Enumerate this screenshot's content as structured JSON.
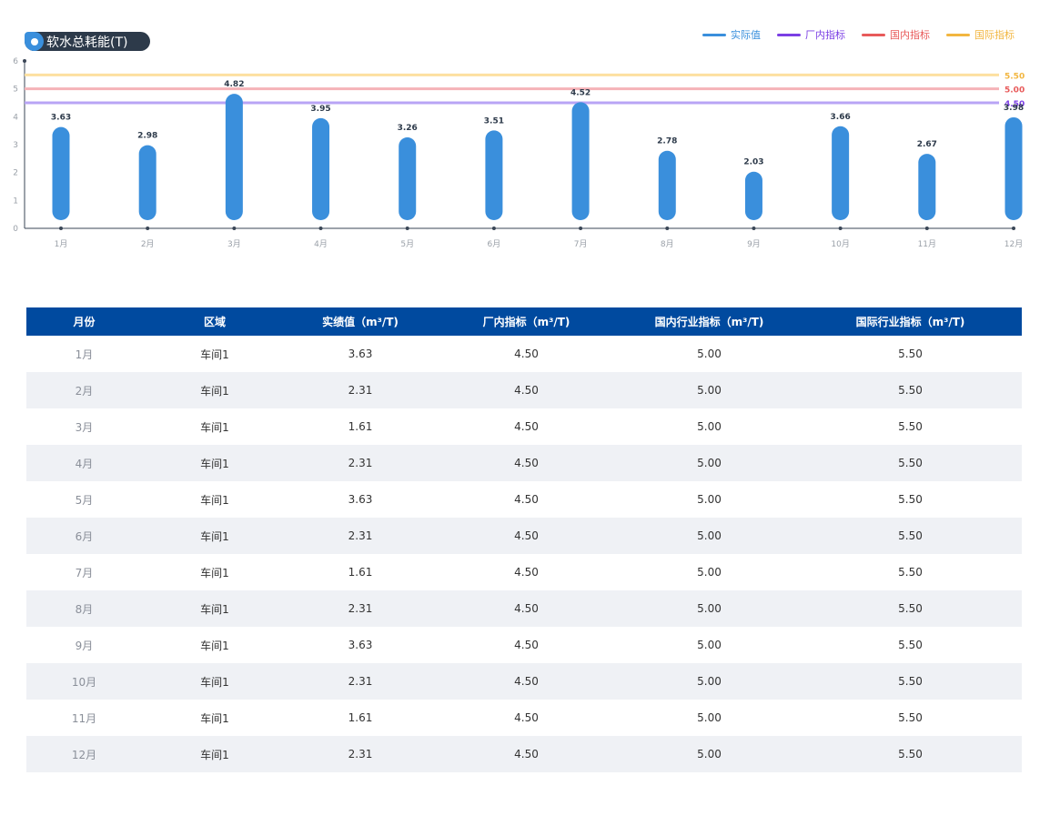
{
  "title": "软水总耗能(T)",
  "legend": [
    {
      "label": "实际值",
      "color": "#3a8fdc"
    },
    {
      "label": "厂内指标",
      "color": "#7b3fe4"
    },
    {
      "label": "国内指标",
      "color": "#e85a5a"
    },
    {
      "label": "国际指标",
      "color": "#f2b640"
    }
  ],
  "chart_data": {
    "type": "bar",
    "categories": [
      "1月",
      "2月",
      "3月",
      "4月",
      "5月",
      "6月",
      "7月",
      "8月",
      "9月",
      "10月",
      "11月",
      "12月"
    ],
    "series": [
      {
        "name": "实际值",
        "values": [
          3.63,
          2.98,
          4.82,
          3.95,
          3.26,
          3.51,
          4.52,
          2.78,
          2.03,
          3.66,
          2.67,
          3.98
        ],
        "color": "#3a8fdc"
      }
    ],
    "reference_lines": [
      {
        "name": "厂内指标",
        "value": 4.5,
        "label": "4.50",
        "color": "#b8a4f5",
        "label_color": "#7b3fe4"
      },
      {
        "name": "国内指标",
        "value": 5.0,
        "label": "5.00",
        "color": "#f5b3b8",
        "label_color": "#e85a5a"
      },
      {
        "name": "国际指标",
        "value": 5.5,
        "label": "5.50",
        "color": "#fde0a0",
        "label_color": "#f2b640"
      }
    ],
    "yticks": [
      "0",
      "1",
      "2",
      "3",
      "4",
      "5",
      "6"
    ],
    "ylim": [
      0,
      6
    ],
    "data_labels": [
      "3.63",
      "2.98",
      "4.82",
      "3.95",
      "3.26",
      "3.51",
      "4.52",
      "2.78",
      "2.03",
      "3.66",
      "2.67",
      "3.98"
    ]
  },
  "table": {
    "headers": [
      "月份",
      "区域",
      "实绩值（m³/T)",
      "厂内指标（m³/T)",
      "国内行业指标（m³/T)",
      "国际行业指标（m³/T)"
    ],
    "rows": [
      [
        "1月",
        "车间1",
        "3.63",
        "4.50",
        "5.00",
        "5.50"
      ],
      [
        "2月",
        "车间1",
        "2.31",
        "4.50",
        "5.00",
        "5.50"
      ],
      [
        "3月",
        "车间1",
        "1.61",
        "4.50",
        "5.00",
        "5.50"
      ],
      [
        "4月",
        "车间1",
        "2.31",
        "4.50",
        "5.00",
        "5.50"
      ],
      [
        "5月",
        "车间1",
        "3.63",
        "4.50",
        "5.00",
        "5.50"
      ],
      [
        "6月",
        "车间1",
        "2.31",
        "4.50",
        "5.00",
        "5.50"
      ],
      [
        "7月",
        "车间1",
        "1.61",
        "4.50",
        "5.00",
        "5.50"
      ],
      [
        "8月",
        "车间1",
        "2.31",
        "4.50",
        "5.00",
        "5.50"
      ],
      [
        "9月",
        "车间1",
        "3.63",
        "4.50",
        "5.00",
        "5.50"
      ],
      [
        "10月",
        "车间1",
        "2.31",
        "4.50",
        "5.00",
        "5.50"
      ],
      [
        "11月",
        "车间1",
        "1.61",
        "4.50",
        "5.00",
        "5.50"
      ],
      [
        "12月",
        "车间1",
        "2.31",
        "4.50",
        "5.00",
        "5.50"
      ]
    ]
  }
}
